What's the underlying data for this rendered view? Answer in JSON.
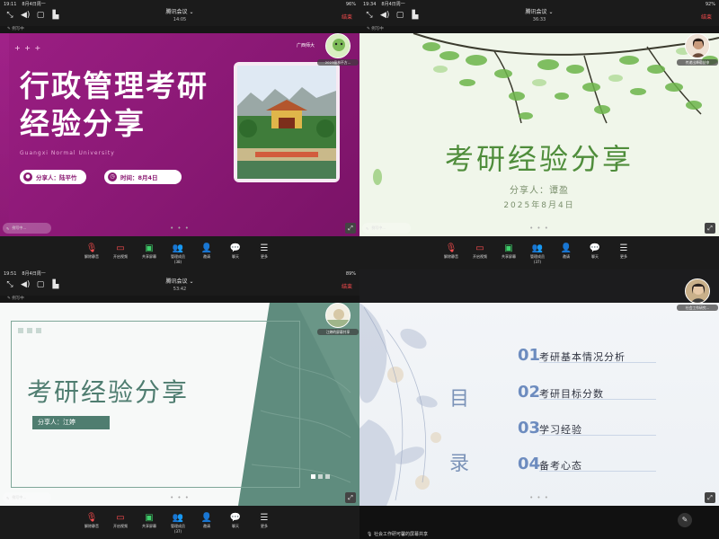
{
  "panes": [
    {
      "status": {
        "time": "19:11",
        "date": "8月4日周一",
        "battery": "96%"
      },
      "meeting": {
        "title": "腾讯会议 ⌄",
        "timer": "14:05",
        "end_label": "结束"
      },
      "share_caption": "例写中",
      "participant": "2023级林不方...",
      "slide": {
        "deco": "+ + +",
        "title_line1": "行政管理考研",
        "title_line2": "经验分享",
        "subtitle": "Guangxi Normal University",
        "presenter": "分享人：陆平竹",
        "time": "时间：8月4日",
        "logo": "广西师大"
      }
    },
    {
      "status": {
        "time": "19:34",
        "date": "8月4日周一",
        "battery": "92%"
      },
      "meeting": {
        "title": "腾讯会议 ⌄",
        "timer": "36:33",
        "end_label": "结束"
      },
      "share_caption": "例写中",
      "participant": "传递出降帮扶申",
      "slide": {
        "title": "考研经验分享",
        "presenter": "分享人：谭盈",
        "date": "2025年8月4日"
      }
    },
    {
      "status": {
        "time": "19:51",
        "date": "8月4日周一",
        "battery": "89%"
      },
      "meeting": {
        "title": "腾讯会议 ⌄",
        "timer": "53:42",
        "end_label": "结束"
      },
      "share_caption": "例写中",
      "participant": "江婷的屏幕共享",
      "slide": {
        "title": "考研经验分享",
        "presenter": "分享人：江婷"
      }
    },
    {
      "participant": "社会工作研究...",
      "caption": "社会工作研可馨的屏幕共享",
      "slide": {
        "mulu_1": "目",
        "mulu_2": "录",
        "items": [
          {
            "num": "01",
            "text": "考研基本情况分析"
          },
          {
            "num": "02",
            "text": "考研目标分数"
          },
          {
            "num": "03",
            "text": "学习经验"
          },
          {
            "num": "04",
            "text": "备考心态"
          }
        ]
      }
    }
  ],
  "toolbar": [
    {
      "label": "解除静音",
      "icon": "mic-off-icon"
    },
    {
      "label": "开启视频",
      "icon": "video-off-icon"
    },
    {
      "label": "共享屏幕",
      "icon": "share-screen-icon"
    },
    {
      "label": "管理成员(38)",
      "icon": "members-icon"
    },
    {
      "label": "邀请",
      "icon": "invite-icon"
    },
    {
      "label": "聊天",
      "icon": "chat-icon"
    },
    {
      "label": "更多",
      "icon": "more-icon"
    }
  ],
  "toolbar_p2_members": "管理成员(37)",
  "toolbar_p3_members": "管理成员(37)",
  "chip_label": "例写中..."
}
